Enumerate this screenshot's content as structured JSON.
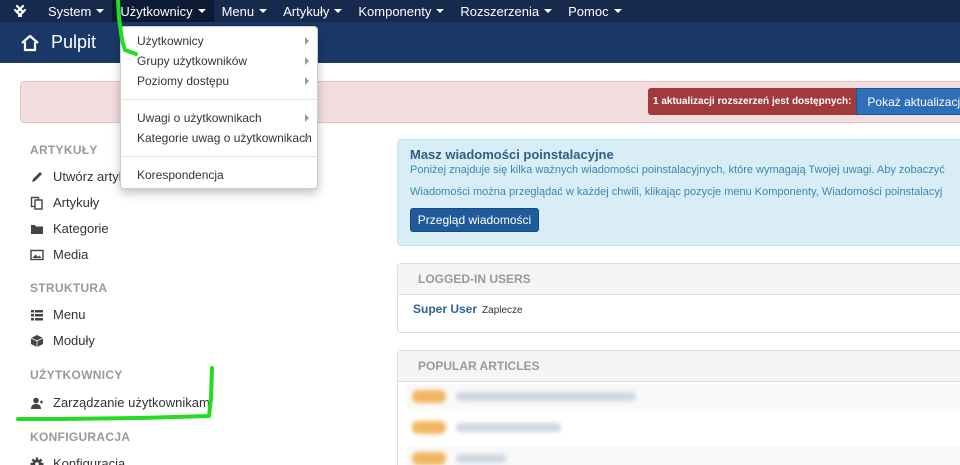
{
  "nav": {
    "items": [
      {
        "label": "System"
      },
      {
        "label": "Użytkownicy"
      },
      {
        "label": "Menu"
      },
      {
        "label": "Artykuły"
      },
      {
        "label": "Komponenty"
      },
      {
        "label": "Rozszerzenia"
      },
      {
        "label": "Pomoc"
      }
    ]
  },
  "header": {
    "title": "Pulpit"
  },
  "alert": {
    "update_text": "1 aktualizacji rozszerzeń jest dostępnych:",
    "update_button": "Pokaż aktualizacje"
  },
  "dropdown": {
    "items": [
      {
        "label": "Użytkownicy"
      },
      {
        "label": "Grupy użytkowników"
      },
      {
        "label": "Poziomy dostępu"
      },
      {
        "label": "Uwagi o użytkownikach"
      },
      {
        "label": "Kategorie uwag o użytkownikach"
      },
      {
        "label": "Korespondencja"
      }
    ]
  },
  "sidebar": {
    "sections": [
      {
        "heading": "ARTYKUŁY",
        "items": [
          {
            "label": "Utwórz artykuł",
            "icon": "pencil-icon"
          },
          {
            "label": "Artykuły",
            "icon": "copy-icon"
          },
          {
            "label": "Kategorie",
            "icon": "folder-icon"
          },
          {
            "label": "Media",
            "icon": "image-icon"
          }
        ]
      },
      {
        "heading": "STRUKTURA",
        "items": [
          {
            "label": "Menu",
            "icon": "list-icon"
          },
          {
            "label": "Moduły",
            "icon": "cube-icon"
          }
        ]
      },
      {
        "heading": "UŻYTKOWNICY",
        "items": [
          {
            "label": "Zarządzanie użytkownikami",
            "icon": "user-icon"
          }
        ]
      },
      {
        "heading": "KONFIGURACJA",
        "items": [
          {
            "label": "Konfiguracja",
            "icon": "gear-icon"
          }
        ]
      }
    ]
  },
  "postinstall": {
    "title": "Masz wiadomości poinstalacyjne",
    "text1": "Poniżej znajduje się kilka ważnych wiadomości poinstalacyjnych, które wymagają Twojej uwagi. Aby zobaczyć",
    "text2": "Wiadomości można przeglądać w każdej chwili, klikając pozycje menu Komponenty, Wiadomości poinstalacyj",
    "button": "Przegląd wiadomości"
  },
  "logged_users": {
    "title": "LOGGED-IN USERS",
    "user_name": "Super User",
    "user_location": "Zaplecze"
  },
  "popular_articles": {
    "title": "POPULAR ARTICLES"
  },
  "colors": {
    "nav_bg": "#162a4d",
    "header_bg": "#1a3867",
    "annotation": "#22dd22"
  }
}
